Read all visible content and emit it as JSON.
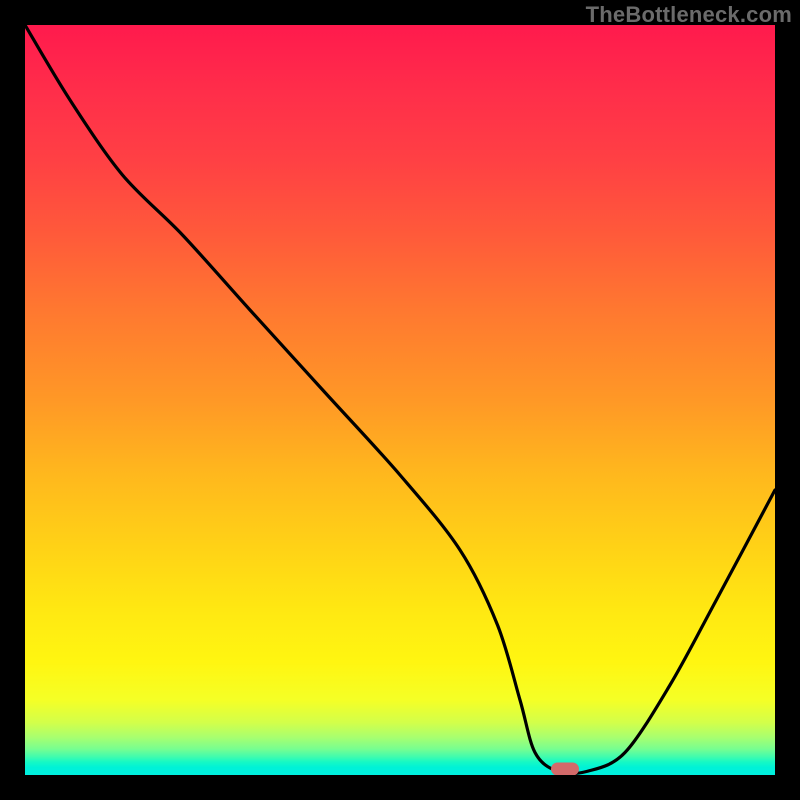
{
  "watermark": "TheBottleneck.com",
  "colors": {
    "frame": "#000000",
    "curve": "#000000",
    "marker": "#d26a6a",
    "gradient_top": "#ff1a4d",
    "gradient_bottom": "#00efe0"
  },
  "chart_data": {
    "type": "line",
    "title": "",
    "xlabel": "",
    "ylabel": "",
    "xlim": [
      0,
      100
    ],
    "ylim": [
      0,
      100
    ],
    "grid": false,
    "series": [
      {
        "name": "bottleneck-curve",
        "x": [
          0,
          6,
          13,
          21,
          30,
          40,
          50,
          58,
          63,
          66,
          68,
          71,
          75,
          80,
          86,
          92,
          100
        ],
        "values": [
          100,
          90,
          80,
          72,
          62,
          51,
          40,
          30,
          20,
          10,
          3,
          0.5,
          0.5,
          3,
          12,
          23,
          38
        ]
      }
    ],
    "annotations": [
      {
        "name": "minimum-marker",
        "x": 72,
        "y": 0.5
      }
    ],
    "colors": {
      "line": "#000000",
      "marker": "#d26a6a"
    }
  }
}
